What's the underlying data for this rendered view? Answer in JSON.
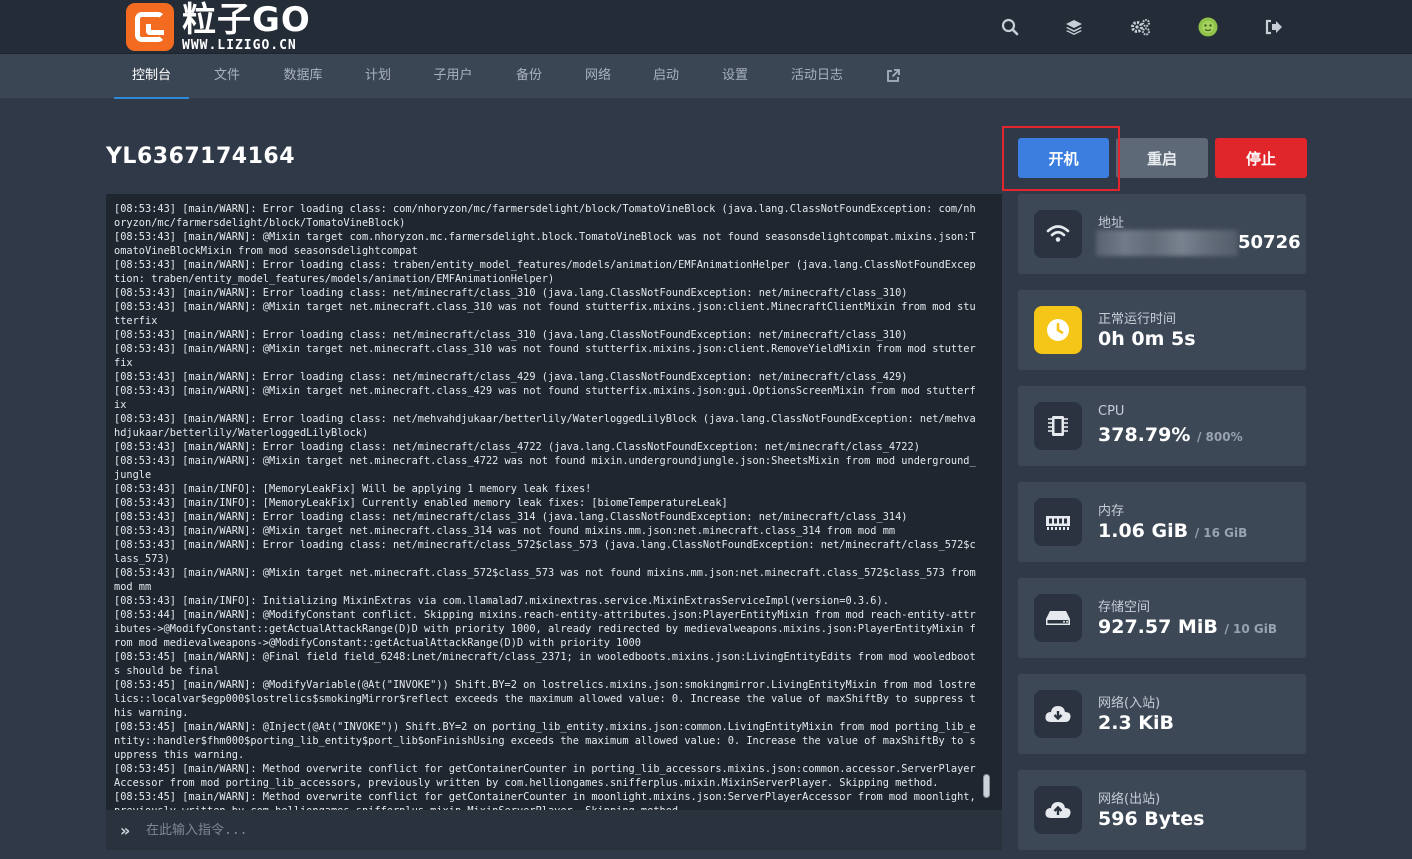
{
  "app": {
    "logo_title": "粒子GO",
    "logo_subtitle": "WWW.LIZIGO.CN",
    "header_icons": [
      "search-icon",
      "layers-icon",
      "cogs-icon",
      "avatar",
      "logout-icon"
    ]
  },
  "nav": {
    "items": [
      {
        "label": "控制台",
        "active": true
      },
      {
        "label": "文件"
      },
      {
        "label": "数据库"
      },
      {
        "label": "计划"
      },
      {
        "label": "子用户"
      },
      {
        "label": "备份"
      },
      {
        "label": "网络"
      },
      {
        "label": "启动"
      },
      {
        "label": "设置"
      },
      {
        "label": "活动日志"
      }
    ],
    "external_icon": "external-link-icon"
  },
  "server": {
    "name": "YL6367174164"
  },
  "power": {
    "start_label": "开机",
    "restart_label": "重启",
    "stop_label": "停止"
  },
  "console": {
    "lines": [
      "[08:53:43] [main/WARN]: Error loading class: com/nhoryzon/mc/farmersdelight/block/TomatoVineBlock (java.lang.ClassNotFoundException: com/nhoryzon/mc/farmersdelight/block/TomatoVineBlock)",
      "[08:53:43] [main/WARN]: @Mixin target com.nhoryzon.mc.farmersdelight.block.TomatoVineBlock was not found seasonsdelightcompat.mixins.json:TomatoVineBlockMixin from mod seasonsdelightcompat",
      "[08:53:43] [main/WARN]: Error loading class: traben/entity_model_features/models/animation/EMFAnimationHelper (java.lang.ClassNotFoundException: traben/entity_model_features/models/animation/EMFAnimationHelper)",
      "[08:53:43] [main/WARN]: Error loading class: net/minecraft/class_310 (java.lang.ClassNotFoundException: net/minecraft/class_310)",
      "[08:53:43] [main/WARN]: @Mixin target net.minecraft.class_310 was not found stutterfix.mixins.json:client.MinecraftClientMixin from mod stutterfix",
      "[08:53:43] [main/WARN]: Error loading class: net/minecraft/class_310 (java.lang.ClassNotFoundException: net/minecraft/class_310)",
      "[08:53:43] [main/WARN]: @Mixin target net.minecraft.class_310 was not found stutterfix.mixins.json:client.RemoveYieldMixin from mod stutterfix",
      "[08:53:43] [main/WARN]: Error loading class: net/minecraft/class_429 (java.lang.ClassNotFoundException: net/minecraft/class_429)",
      "[08:53:43] [main/WARN]: @Mixin target net.minecraft.class_429 was not found stutterfix.mixins.json:gui.OptionsScreenMixin from mod stutterfix",
      "[08:53:43] [main/WARN]: Error loading class: net/mehvahdjukaar/betterlily/WaterloggedLilyBlock (java.lang.ClassNotFoundException: net/mehvahdjukaar/betterlily/WaterloggedLilyBlock)",
      "[08:53:43] [main/WARN]: Error loading class: net/minecraft/class_4722 (java.lang.ClassNotFoundException: net/minecraft/class_4722)",
      "[08:53:43] [main/WARN]: @Mixin target net.minecraft.class_4722 was not found mixin.undergroundjungle.json:SheetsMixin from mod underground_jungle",
      "[08:53:43] [main/INFO]: [MemoryLeakFix] Will be applying 1 memory leak fixes!",
      "[08:53:43] [main/INFO]: [MemoryLeakFix] Currently enabled memory leak fixes: [biomeTemperatureLeak]",
      "[08:53:43] [main/WARN]: Error loading class: net/minecraft/class_314 (java.lang.ClassNotFoundException: net/minecraft/class_314)",
      "[08:53:43] [main/WARN]: @Mixin target net.minecraft.class_314 was not found mixins.mm.json:net.minecraft.class_314 from mod mm",
      "[08:53:43] [main/WARN]: Error loading class: net/minecraft/class_572$class_573 (java.lang.ClassNotFoundException: net/minecraft/class_572$class_573)",
      "[08:53:43] [main/WARN]: @Mixin target net.minecraft.class_572$class_573 was not found mixins.mm.json:net.minecraft.class_572$class_573 from mod mm",
      "[08:53:43] [main/INFO]: Initializing MixinExtras via com.llamalad7.mixinextras.service.MixinExtrasServiceImpl(version=0.3.6).",
      "[08:53:44] [main/WARN]: @ModifyConstant conflict. Skipping mixins.reach-entity-attributes.json:PlayerEntityMixin from mod reach-entity-attributes->@ModifyConstant::getActualAttackRange(D)D with priority 1000, already redirected by medievalweapons.mixins.json:PlayerEntityMixin from mod medievalweapons->@ModifyConstant::getActualAttackRange(D)D with priority 1000",
      "[08:53:45] [main/WARN]: @Final field field_6248:Lnet/minecraft/class_2371; in wooledboots.mixins.json:LivingEntityEdits from mod wooledboots should be final",
      "[08:53:45] [main/WARN]: @ModifyVariable(@At(\"INVOKE\")) Shift.BY=2 on lostrelics.mixins.json:smokingmirror.LivingEntityMixin from mod lostrelics::localvar$egp000$lostrelics$smokingMirror$reflect exceeds the maximum allowed value: 0. Increase the value of maxShiftBy to suppress this warning.",
      "[08:53:45] [main/WARN]: @Inject(@At(\"INVOKE\")) Shift.BY=2 on porting_lib_entity.mixins.json:common.LivingEntityMixin from mod porting_lib_entity::handler$fhm000$porting_lib_entity$port_lib$onFinishUsing exceeds the maximum allowed value: 0. Increase the value of maxShiftBy to suppress this warning.",
      "[08:53:45] [main/WARN]: Method overwrite conflict for getContainerCounter in porting_lib_accessors.mixins.json:common.accessor.ServerPlayerAccessor from mod porting_lib_accessors, previously written by com.helliongames.snifferplus.mixin.MixinServerPlayer. Skipping method.",
      "[08:53:45] [main/WARN]: Method overwrite conflict for getContainerCounter in moonlight.mixins.json:ServerPlayerAccessor from mod moonlight, previously written by com.helliongames.snifferplus.mixin.MixinServerPlayer. Skipping method."
    ],
    "input_placeholder": "在此输入指令...",
    "prompt_glyph": "»"
  },
  "stats": {
    "address": {
      "label": "地址",
      "port_suffix": "50726",
      "icon": "wifi-icon"
    },
    "uptime": {
      "label": "正常运行时间",
      "value": "0h 0m 5s",
      "icon": "clock-icon",
      "icon_color": "#f5c518"
    },
    "cpu": {
      "label": "CPU",
      "value": "378.79%",
      "limit": "/ 800%",
      "icon": "cpu-icon"
    },
    "memory": {
      "label": "内存",
      "value": "1.06 GiB",
      "limit": "/ 16 GiB",
      "icon": "memory-icon"
    },
    "disk": {
      "label": "存储空间",
      "value": "927.57 MiB",
      "limit": "/ 10 GiB",
      "icon": "hdd-icon"
    },
    "net_in": {
      "label": "网络(入站)",
      "value": "2.3 KiB",
      "icon": "cloud-download-icon"
    },
    "net_out": {
      "label": "网络(出站)",
      "value": "596 Bytes",
      "icon": "cloud-upload-icon"
    }
  },
  "colors": {
    "start": "#3b7ee0",
    "restart": "#5d6977",
    "stop": "#e0262b",
    "accent": "#2e8ad8",
    "brand": "#f36a21"
  }
}
